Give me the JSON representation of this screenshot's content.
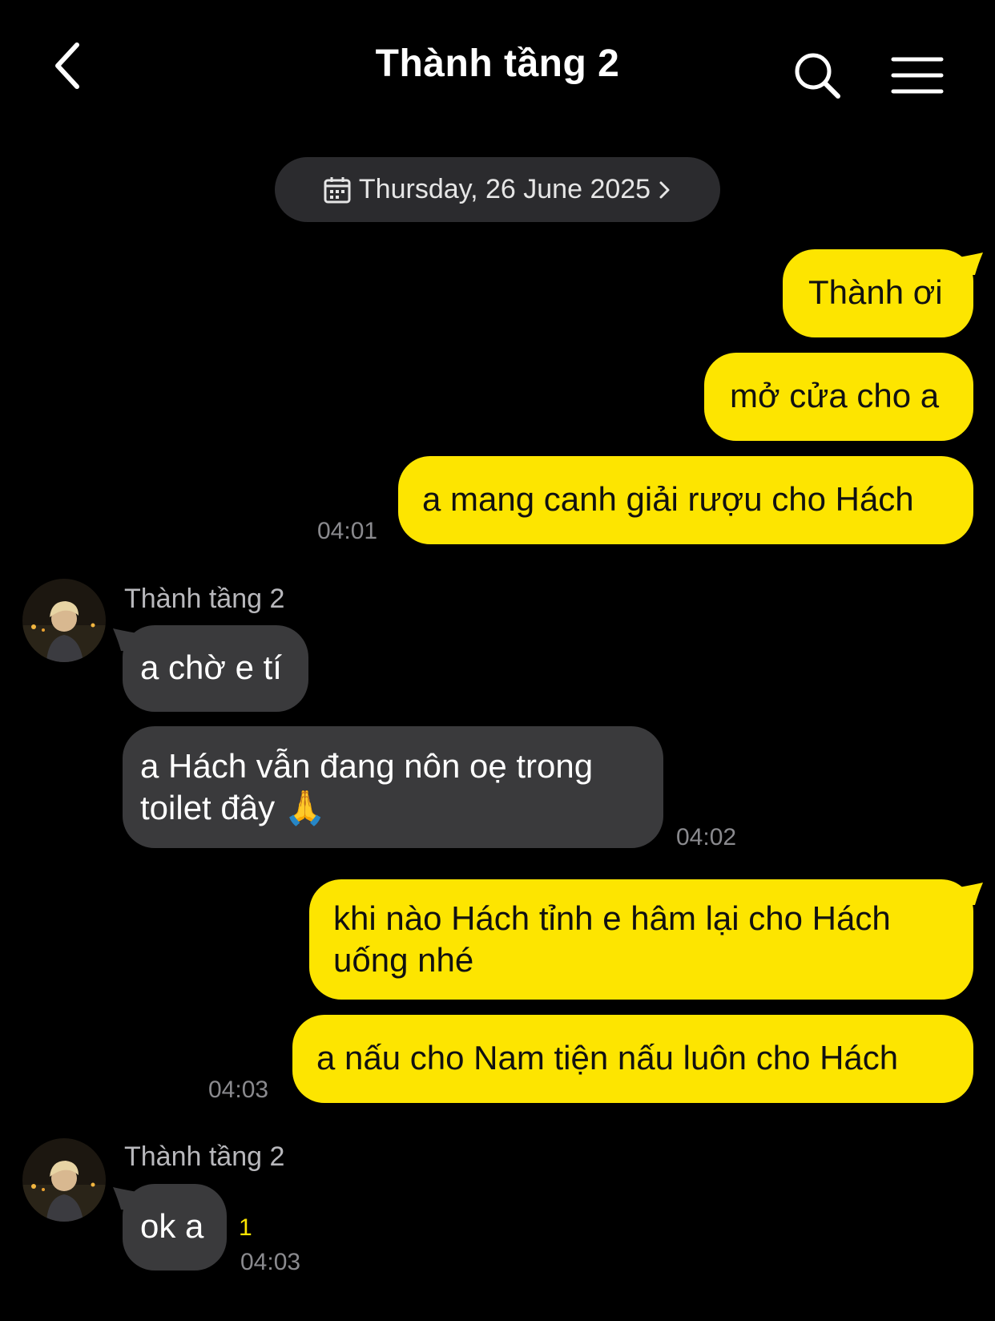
{
  "header": {
    "title": "Thành tầng 2"
  },
  "icons": {
    "back": "chevron-left-icon",
    "search": "search-icon",
    "menu": "hamburger-menu-icon",
    "calendar": "calendar-icon"
  },
  "colors": {
    "background": "#000000",
    "outgoing_bubble": "#fde500",
    "incoming_bubble": "#3a3a3c",
    "timestamp": "#8a8a8e",
    "unread": "#fde500"
  },
  "date_divider": {
    "label": "Thursday, 26 June 2025"
  },
  "messages": [
    {
      "direction": "out",
      "text": "Thành ơi"
    },
    {
      "direction": "out",
      "text": "mở cửa cho a"
    },
    {
      "direction": "out",
      "text": "a mang canh giải rượu cho Hách",
      "time": "04:01"
    },
    {
      "direction": "in",
      "sender": "Thành tầng 2",
      "text": "a chờ e tí"
    },
    {
      "direction": "in",
      "line1": "a Hách vẫn đang nôn oẹ trong",
      "line2": "toilet đây 🙏",
      "time": "04:02"
    },
    {
      "direction": "out",
      "line1": "khi nào Hách tỉnh e hâm lại cho Hách",
      "line2": "uống nhé"
    },
    {
      "direction": "out",
      "text": "a nấu cho Nam tiện nấu luôn cho Hách",
      "time": "04:03"
    },
    {
      "direction": "in",
      "sender": "Thành tầng 2",
      "text": "ok a",
      "unread": "1",
      "time": "04:03"
    }
  ]
}
